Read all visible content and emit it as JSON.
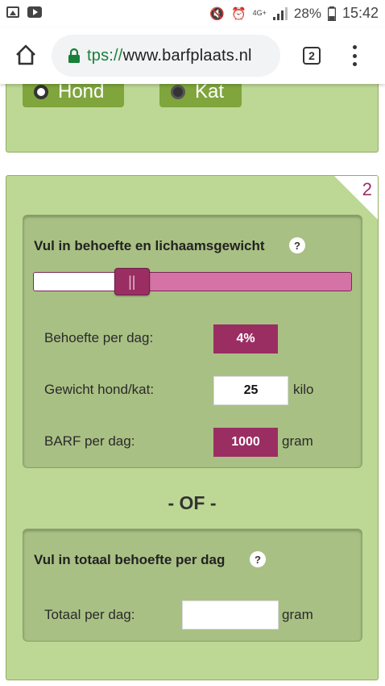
{
  "status_bar": {
    "signal_label": "4G+",
    "battery": "28%",
    "time": "15:42"
  },
  "browser": {
    "url_scheme": "tps://",
    "url_host": "www.barfplaats.nl",
    "tab_count": "2"
  },
  "animal_choice": {
    "options": [
      {
        "label": "Hond",
        "selected": true
      },
      {
        "label": "Kat",
        "selected": false
      }
    ]
  },
  "step": {
    "number": "2",
    "section1": {
      "title": "Vul in behoefte en lichaamsgewicht",
      "help": "?",
      "slider": {
        "fraction": 0.31,
        "handle_glyph": "||"
      },
      "rows": [
        {
          "label": "Behoefte per dag:",
          "value": "4%",
          "unit": ""
        },
        {
          "label": "Gewicht hond/kat:",
          "value": "25",
          "unit": "kilo"
        },
        {
          "label": "BARF per dag:",
          "value": "1000",
          "unit": "gram"
        }
      ]
    },
    "separator": "- OF -",
    "section2": {
      "title": "Vul in totaal behoefte per dag",
      "help": "?",
      "row": {
        "label": "Totaal per dag:",
        "value": "",
        "unit": "gram"
      }
    }
  },
  "colors": {
    "panel_green": "#bdd895",
    "inner_green": "#a9c084",
    "button_green": "#7fa53c",
    "accent_purple": "#9a2e62",
    "slider_pink": "#d573a6"
  }
}
